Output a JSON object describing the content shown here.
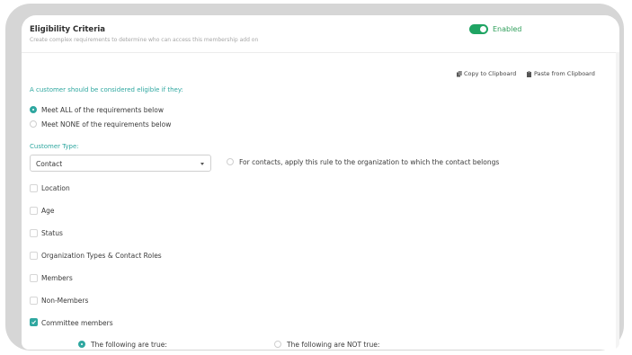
{
  "header": {
    "title": "Eligibility Criteria",
    "subtitle": "Create complex requirements to determine who can access this membership add on",
    "toggle_label": "Enabled",
    "toggle_on": true
  },
  "clipboard": {
    "copy_label": "Copy to Clipboard",
    "paste_label": "Paste from Clipboard"
  },
  "eligibility": {
    "prompt": "A customer should be considered eligible if they:",
    "options": [
      {
        "label": "Meet ALL of the requirements below",
        "selected": true
      },
      {
        "label": "Meet NONE of the requirements below",
        "selected": false
      }
    ]
  },
  "customer_type": {
    "label": "Customer Type:",
    "value": "Contact",
    "org_rule_label": "For contacts, apply this rule to the organization to which the contact belongs",
    "org_rule_checked": false
  },
  "criteria": [
    {
      "label": "Location",
      "checked": false
    },
    {
      "label": "Age",
      "checked": false
    },
    {
      "label": "Status",
      "checked": false
    },
    {
      "label": "Organization Types & Contact Roles",
      "checked": false
    },
    {
      "label": "Members",
      "checked": false
    },
    {
      "label": "Non-Members",
      "checked": false
    },
    {
      "label": "Committee members",
      "checked": true
    }
  ],
  "committee": {
    "true_label": "The following are true:",
    "not_true_label": "The following are NOT true:",
    "selected": "true"
  },
  "colors": {
    "accent": "#2fa7a0",
    "toggle": "#1fa463"
  }
}
